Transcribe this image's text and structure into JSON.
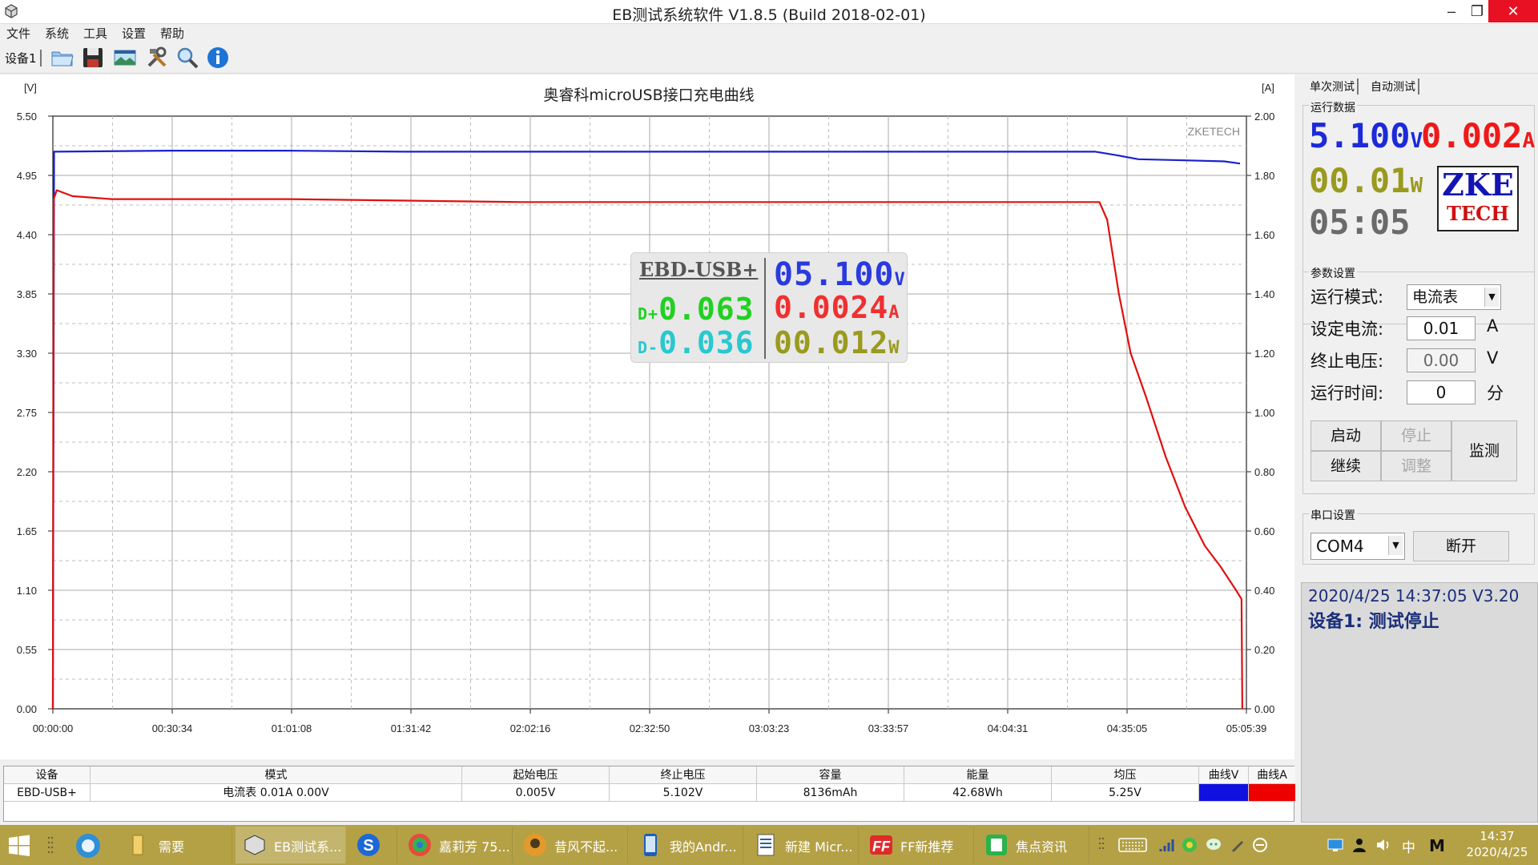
{
  "window": {
    "title": "EB测试系统软件 V1.8.5 (Build 2018-02-01)"
  },
  "menu": [
    "文件",
    "系统",
    "工具",
    "设置",
    "帮助"
  ],
  "toolbar": {
    "device_tab": "设备1"
  },
  "chart_data": {
    "type": "line",
    "title": "奥睿科microUSB接口充电曲线",
    "watermark": "ZKETECH",
    "y_left": {
      "unit": "[V]",
      "ticks": [
        "5.50",
        "4.95",
        "4.40",
        "3.85",
        "3.30",
        "2.75",
        "2.20",
        "1.65",
        "1.10",
        "0.55",
        "0.00"
      ],
      "range": [
        0,
        5.5
      ]
    },
    "y_right": {
      "unit": "[A]",
      "ticks": [
        "2.00",
        "1.80",
        "1.60",
        "1.40",
        "1.20",
        "1.00",
        "0.80",
        "0.60",
        "0.40",
        "0.20",
        "0.00"
      ],
      "range": [
        0,
        2.0
      ]
    },
    "x_ticks": [
      "00:00:00",
      "00:30:34",
      "01:01:08",
      "01:31:42",
      "02:02:16",
      "02:32:50",
      "03:03:23",
      "03:33:57",
      "04:04:31",
      "04:35:05",
      "05:05:39"
    ],
    "x_range_minutes": [
      0,
      305.65
    ],
    "series": [
      {
        "name": "曲线V",
        "color": "#1a22cc",
        "axis": "left",
        "points": [
          [
            0,
            0.0
          ],
          [
            0.3,
            5.17
          ],
          [
            30,
            5.18
          ],
          [
            60,
            5.18
          ],
          [
            90,
            5.17
          ],
          [
            120,
            5.17
          ],
          [
            150,
            5.17
          ],
          [
            180,
            5.17
          ],
          [
            210,
            5.17
          ],
          [
            240,
            5.17
          ],
          [
            267,
            5.17
          ],
          [
            272,
            5.14
          ],
          [
            278,
            5.1
          ],
          [
            290,
            5.09
          ],
          [
            300,
            5.08
          ],
          [
            304,
            5.06
          ]
        ]
      },
      {
        "name": "曲线A",
        "color": "#e01010",
        "axis": "right",
        "points": [
          [
            0,
            0.0
          ],
          [
            0.2,
            1.72
          ],
          [
            1,
            1.75
          ],
          [
            5,
            1.73
          ],
          [
            15,
            1.72
          ],
          [
            60,
            1.72
          ],
          [
            120,
            1.71
          ],
          [
            180,
            1.71
          ],
          [
            240,
            1.71
          ],
          [
            268,
            1.71
          ],
          [
            270,
            1.65
          ],
          [
            273,
            1.4
          ],
          [
            276,
            1.2
          ],
          [
            280,
            1.05
          ],
          [
            285,
            0.85
          ],
          [
            290,
            0.68
          ],
          [
            295,
            0.55
          ],
          [
            299,
            0.48
          ],
          [
            303,
            0.4
          ],
          [
            304.4,
            0.37
          ],
          [
            304.6,
            0.0
          ]
        ]
      }
    ]
  },
  "lcd": {
    "model": "EBD-USB+",
    "voltage": "05.100",
    "voltage_unit": "V",
    "dplus_label": "D+",
    "dplus": "0.063",
    "current": "0.0024",
    "current_unit": "A",
    "dminus_label": "D-",
    "dminus": "0.036",
    "power": "00.012",
    "power_unit": "W"
  },
  "table": {
    "headers": [
      "设备",
      "模式",
      "起始电压",
      "终止电压",
      "容量",
      "能量",
      "均压",
      "曲线V",
      "曲线A"
    ],
    "row": [
      "EBD-USB+",
      "电流表  0.01A  0.00V",
      "0.005V",
      "5.102V",
      "8136mAh",
      "42.68Wh",
      "5.25V",
      "",
      ""
    ],
    "colors": {
      "curve_v": "#1010e0",
      "curve_a": "#ee0000"
    }
  },
  "right_panel": {
    "tabs": [
      "单次测试",
      "自动测试"
    ],
    "run_data": {
      "title": "运行数据",
      "voltage": "5.100",
      "voltage_unit": "V",
      "current": "0.002",
      "current_unit": "A",
      "power": "00.01",
      "power_unit": "W",
      "time": "05:05",
      "logo_line1": "ZKE",
      "logo_line2": "TECH"
    },
    "params": {
      "title": "参数设置",
      "mode_label": "运行模式:",
      "mode_value": "电流表",
      "current_label": "设定电流:",
      "current_value": "0.01",
      "current_unit": "A",
      "end_voltage_label": "终止电压:",
      "end_voltage_value": "0.00",
      "end_voltage_unit": "V",
      "run_time_label": "运行时间:",
      "run_time_value": "0",
      "run_time_unit": "分",
      "btn_start": "启动",
      "btn_stop": "停止",
      "btn_continue": "继续",
      "btn_adjust": "调整",
      "btn_monitor": "监测"
    },
    "serial": {
      "title": "串口设置",
      "port": "COM4",
      "btn_disconnect": "断开"
    },
    "status": {
      "line1": "2020/4/25 14:37:05  V3.20",
      "line2": "设备1: 测试停止"
    }
  },
  "taskbar": {
    "items": [
      "需要",
      "EB测试系...",
      "",
      "嘉莉芳 75...",
      "昔风不起...",
      "我的Andr...",
      "新建 Micr...",
      "FF新推荐",
      "焦点资讯"
    ],
    "clock_time": "14:37",
    "clock_date": "2020/4/25",
    "ime": "中",
    "ime2": "M"
  }
}
